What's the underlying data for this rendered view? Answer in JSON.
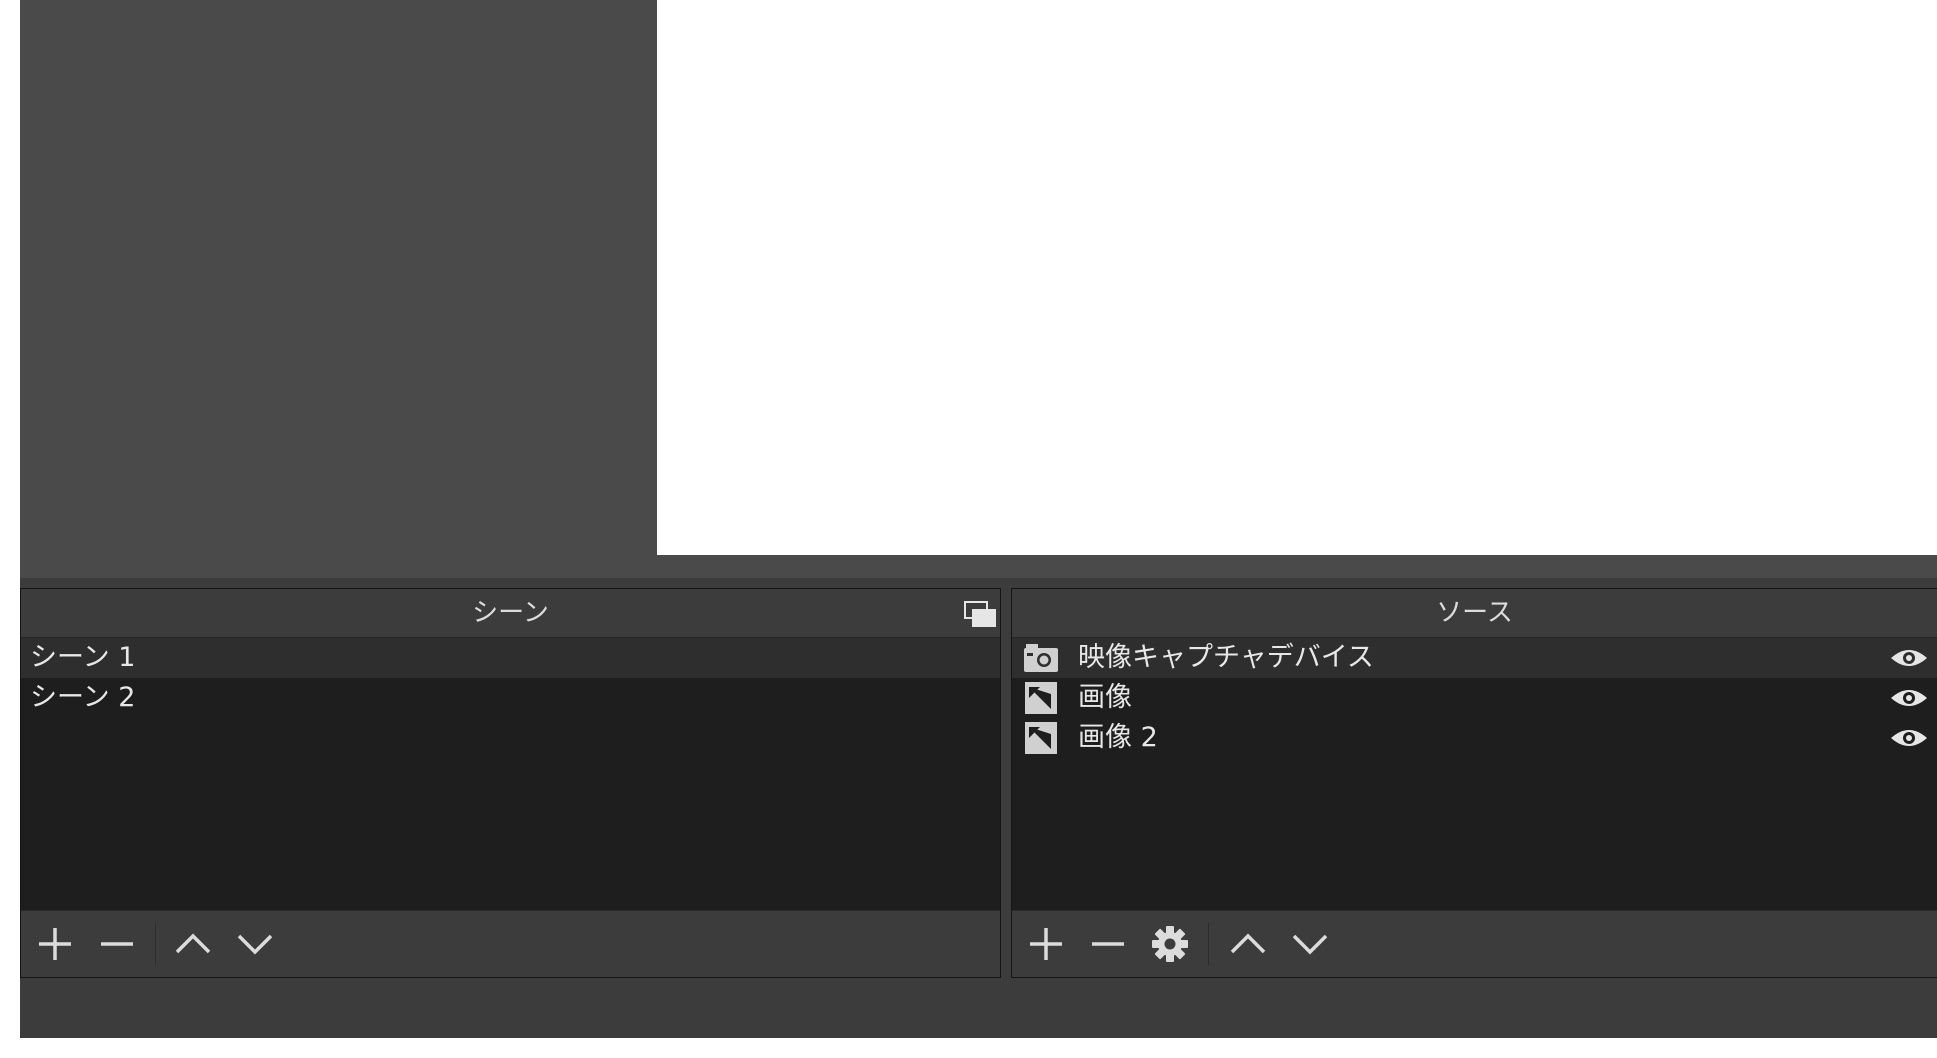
{
  "scenes_dock": {
    "title": "シーン",
    "items": [
      {
        "label": "シーン 1",
        "selected": true
      },
      {
        "label": "シーン 2",
        "selected": false
      }
    ],
    "toolbar_icons": [
      "plus-icon",
      "minus-icon",
      "chevron-up-icon",
      "chevron-down-icon"
    ]
  },
  "sources_dock": {
    "title": "ソース",
    "items": [
      {
        "label": "映像キャプチャデバイス",
        "icon": "camera-icon",
        "visible": true,
        "selected": true
      },
      {
        "label": "画像",
        "icon": "image-icon",
        "visible": true,
        "selected": false
      },
      {
        "label": "画像 2",
        "icon": "image-icon",
        "visible": true,
        "selected": false
      }
    ],
    "toolbar_icons": [
      "plus-icon",
      "minus-icon",
      "gear-icon",
      "chevron-up-icon",
      "chevron-down-icon"
    ]
  },
  "colors": {
    "panel": "#3c3c3c",
    "list_bg": "#1e1e1e",
    "selected_row": "#2e2e2e",
    "preview_canvas": "#ffffff"
  }
}
